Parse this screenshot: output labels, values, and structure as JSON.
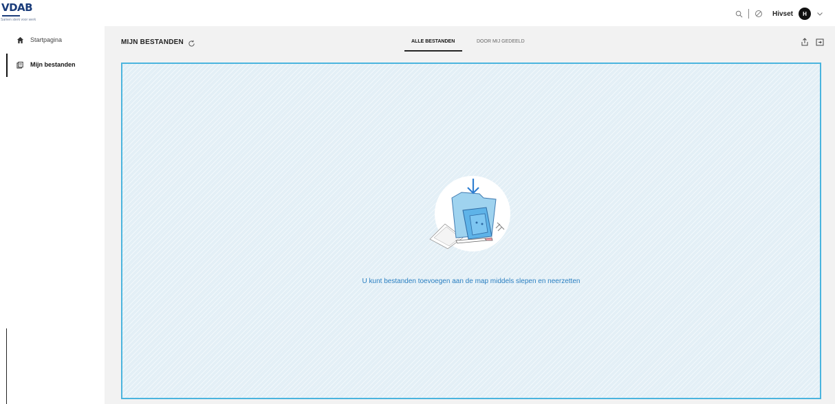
{
  "brand": {
    "logo_text": "VDAB",
    "logo_sub": "Samen sterk voor werk"
  },
  "topbar": {
    "user_name": "Hivset",
    "avatar_initial": "H"
  },
  "sidebar": {
    "items": [
      {
        "label": "Startpagina",
        "icon": "home-icon",
        "active": false
      },
      {
        "label": "Mijn bestanden",
        "icon": "files-icon",
        "active": true
      }
    ]
  },
  "main": {
    "title": "MIJN BESTANDEN",
    "tabs": [
      {
        "label": "ALLE BESTANDEN",
        "active": true
      },
      {
        "label": "DOOR MIJ GEDEELD",
        "active": false
      }
    ],
    "actions": [
      "share-icon",
      "new-folder-icon"
    ]
  },
  "dropzone": {
    "message": "U kunt bestanden toevoegen aan de map middels slepen en neerzetten"
  },
  "colors": {
    "accent": "#2a7fc1",
    "border": "#4ab4de",
    "dropzone_bg": "#e3eff6"
  }
}
